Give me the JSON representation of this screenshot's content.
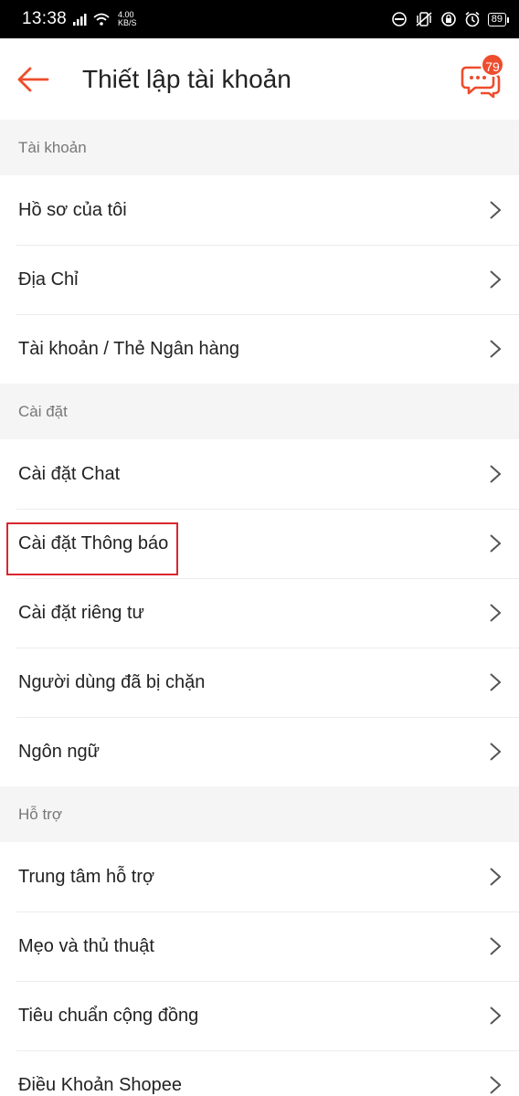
{
  "status_bar": {
    "time": "13:38",
    "speed_value": "4.00",
    "speed_unit": "KB/S",
    "battery": "89"
  },
  "header": {
    "title": "Thiết lập tài khoản",
    "chat_badge": "79",
    "accent_color": "#ee4d2d"
  },
  "sections": [
    {
      "title": "Tài khoản",
      "items": [
        "Hồ sơ của tôi",
        "Địa Chỉ",
        "Tài khoản / Thẻ Ngân hàng"
      ]
    },
    {
      "title": "Cài đặt",
      "items": [
        "Cài đặt Chat",
        "Cài đặt Thông báo",
        "Cài đặt riêng tư",
        "Người dùng đã bị chặn",
        "Ngôn ngữ"
      ]
    },
    {
      "title": "Hỗ trợ",
      "items": [
        "Trung tâm hỗ trợ",
        "Mẹo và thủ thuật",
        "Tiêu chuẩn cộng đồng",
        "Điều Khoản Shopee"
      ]
    }
  ],
  "highlighted_item": "Cài đặt Thông báo",
  "icons": {
    "back": "arrow-left-icon",
    "chat": "chat-bubble-icon",
    "row": "chevron-right-icon"
  }
}
